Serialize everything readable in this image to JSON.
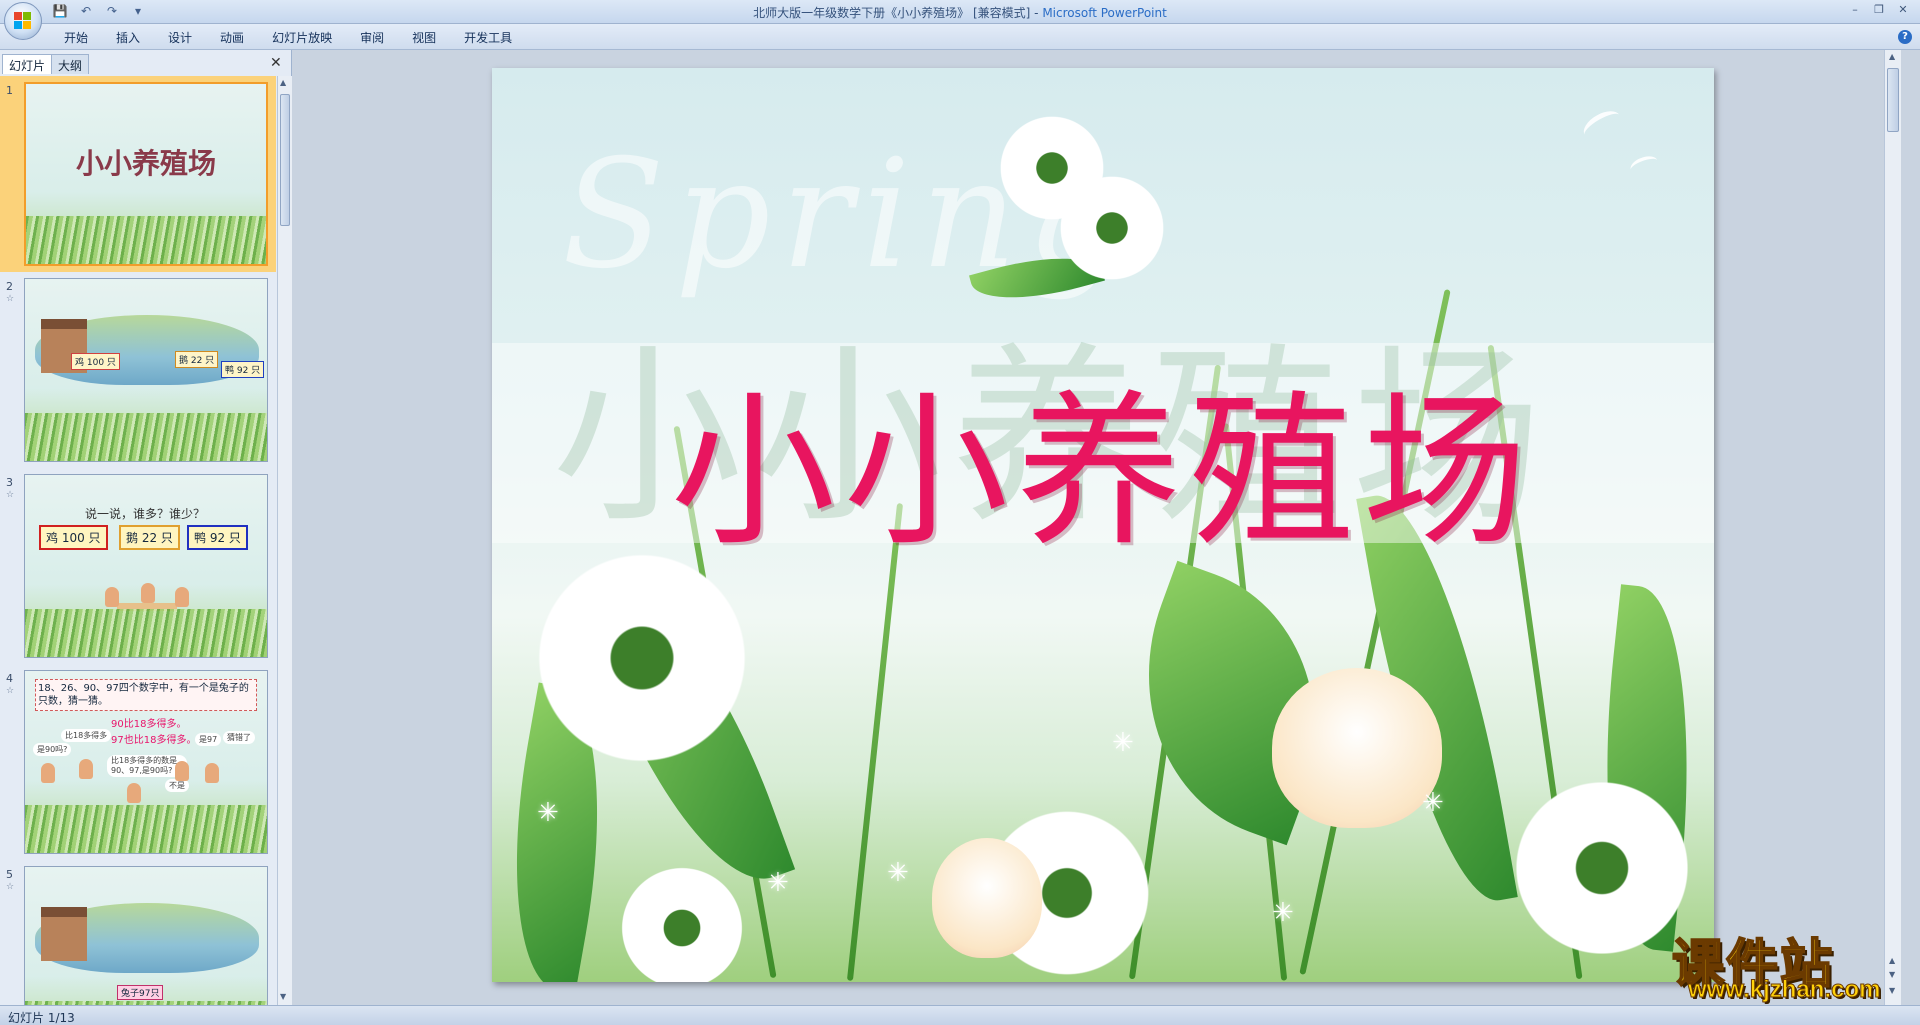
{
  "window": {
    "title": "北师大版一年级数学下册《小小养殖场》 [兼容模式] - ",
    "app_name": "Microsoft PowerPoint"
  },
  "qat": {
    "save_icon": "save-icon",
    "undo_icon": "undo-icon",
    "redo_icon": "redo-icon"
  },
  "ribbon": {
    "tabs": [
      "开始",
      "插入",
      "设计",
      "动画",
      "幻灯片放映",
      "审阅",
      "视图",
      "开发工具"
    ]
  },
  "left_pane": {
    "tabs": [
      "幻灯片",
      "大纲"
    ],
    "thumbnails": [
      {
        "number": "1",
        "title": "小小养殖场"
      },
      {
        "number": "2",
        "labels": [
          "鸡 100 只",
          "鹅 22 只",
          "鸭 92 只"
        ]
      },
      {
        "number": "3",
        "title": "说一说，谁多？谁少？",
        "labels": [
          "鸡 100 只",
          "鹅 22 只",
          "鸭 92 只"
        ]
      },
      {
        "number": "4",
        "note": "18、26、90、97四个数字中，有一个是兔子的只数，猜一猜。",
        "lines": [
          "90比18多得多。",
          "97也比18多得多。"
        ],
        "bubbles": [
          "比18多得多",
          "是90吗?",
          "比18多得多的数是90、97,是90吗?",
          "是97",
          "不是",
          "猜错了"
        ]
      },
      {
        "number": "5",
        "caption": "兔子97只"
      }
    ]
  },
  "slide": {
    "watermark": "Spring",
    "title": "小小养殖场"
  },
  "brand": {
    "name": "课件站",
    "url": "www.kjzhan.com"
  },
  "status": {
    "slide_counter": "幻灯片 1/13"
  },
  "colors": {
    "title_pink": "#e8155f",
    "selected_thumb": "#f29d2a"
  }
}
